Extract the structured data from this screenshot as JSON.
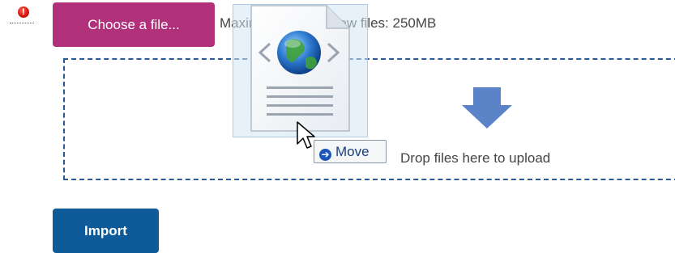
{
  "error": {
    "icon": "exclamation-circle-icon",
    "glyph": "!",
    "color": "#d3140a"
  },
  "upload": {
    "choose_label": "Choose a file...",
    "max_size_text": "Maximum size for new files: 250MB",
    "drop_text": "Drop files here to upload",
    "drop_arrow_icon": "arrow-down-icon",
    "choose_color": "#b1307a",
    "dropzone_border_color": "#2b5a95"
  },
  "drag": {
    "file_icon": "html-file-icon",
    "effect_icon": "move-arrow-icon",
    "effect_glyph": "➔",
    "effect_label": "Move",
    "cursor_icon": "mouse-pointer-icon"
  },
  "actions": {
    "import_label": "Import",
    "import_color": "#0f5a98"
  }
}
